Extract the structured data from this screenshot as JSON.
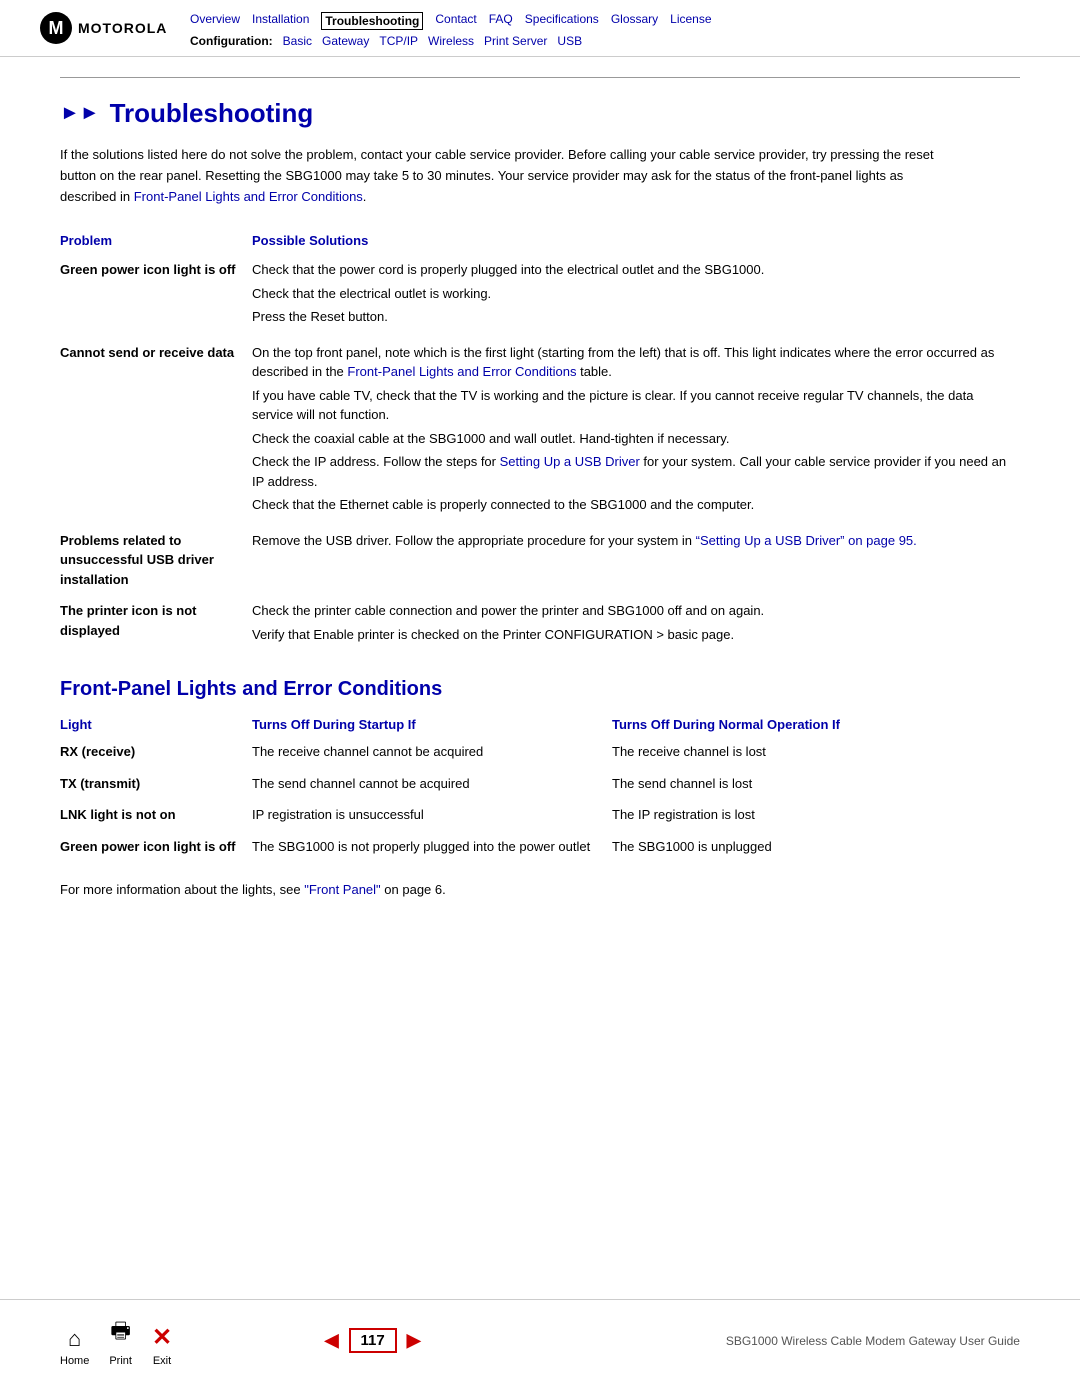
{
  "header": {
    "logo_text": "MOTOROLA",
    "nav_top": [
      {
        "label": "Overview",
        "active": false
      },
      {
        "label": "Installation",
        "active": false
      },
      {
        "label": "Troubleshooting",
        "active": true
      },
      {
        "label": "Contact",
        "active": false
      },
      {
        "label": "FAQ",
        "active": false
      },
      {
        "label": "Specifications",
        "active": false
      },
      {
        "label": "Glossary",
        "active": false
      },
      {
        "label": "License",
        "active": false
      }
    ],
    "nav_config_label": "Configuration:",
    "nav_bottom": [
      {
        "label": "Basic"
      },
      {
        "label": "Gateway"
      },
      {
        "label": "TCP/IP"
      },
      {
        "label": "Wireless"
      },
      {
        "label": "Print Server"
      },
      {
        "label": "USB"
      }
    ]
  },
  "page": {
    "title": "Troubleshooting",
    "intro": "If the solutions listed here do not solve the problem, contact your cable service provider. Before calling your cable service provider, try pressing the reset button on the rear panel. Resetting the SBG1000 may take 5 to 30 minutes. Your service provider may ask for the status of the front-panel lights as described in",
    "intro_link": "Front-Panel Lights and Error Conditions",
    "intro_end": ".",
    "problem_table": {
      "col_problem": "Problem",
      "col_solution": "Possible Solutions",
      "rows": [
        {
          "problem": "Green power icon light is off",
          "solutions": [
            "Check that the power cord is properly plugged into the electrical outlet and the SBG1000.",
            "Check that the electrical outlet is working.",
            "Press the Reset button."
          ]
        },
        {
          "problem": "Cannot send or receive data",
          "solutions": [
            "On the top front panel, note which is the first light (starting from the left) that is off. This light indicates where the error occurred as described in the [Front-Panel Lights and Error Conditions] table.",
            "If you have cable TV, check that the TV is working and the picture is clear. If you cannot receive regular TV channels, the data service will not function.",
            "Check the coaxial cable at the SBG1000 and wall outlet. Hand-tighten if necessary.",
            "Check the IP address. Follow the steps for [Setting Up a USB Driver] for your system. Call your cable service provider if you need an IP address.",
            "Check that the Ethernet cable is properly connected to the SBG1000 and the computer."
          ]
        },
        {
          "problem": "Problems related to unsuccessful USB driver installation",
          "solutions": [
            "Remove the USB driver. Follow the appropriate procedure for your system in “Setting Up a USB Driver” on page 95."
          ]
        },
        {
          "problem": "The printer icon is not displayed",
          "solutions": [
            "Check the printer cable connection and power the printer and SBG1000 off and on again.",
            "Verify that Enable printer is checked on the Printer CONFIGURATION > basic page."
          ]
        }
      ]
    },
    "front_panel_section": {
      "heading": "Front-Panel Lights and Error Conditions",
      "col_light": "Light",
      "col_startup": "Turns Off During Startup If",
      "col_normal": "Turns Off During Normal Operation If",
      "rows": [
        {
          "light": "RX (receive)",
          "startup": "The receive channel cannot be acquired",
          "normal": "The receive channel is lost"
        },
        {
          "light": "TX (transmit)",
          "startup": "The send channel cannot be acquired",
          "normal": "The send channel is lost"
        },
        {
          "light": "LNK light is not on",
          "startup": "IP registration is unsuccessful",
          "normal": "The IP registration is lost"
        },
        {
          "light": "Green power icon light is off",
          "startup": "The SBG1000 is not properly plugged into the power outlet",
          "normal": "The SBG1000 is unplugged"
        }
      ],
      "footer": "For more information about the lights, see “Front Panel” on page 6."
    },
    "bottom_nav": {
      "page_number": "117",
      "guide_title": "SBG1000 Wireless Cable Modem Gateway User Guide",
      "home_label": "Home",
      "print_label": "Print",
      "exit_label": "Exit"
    }
  }
}
